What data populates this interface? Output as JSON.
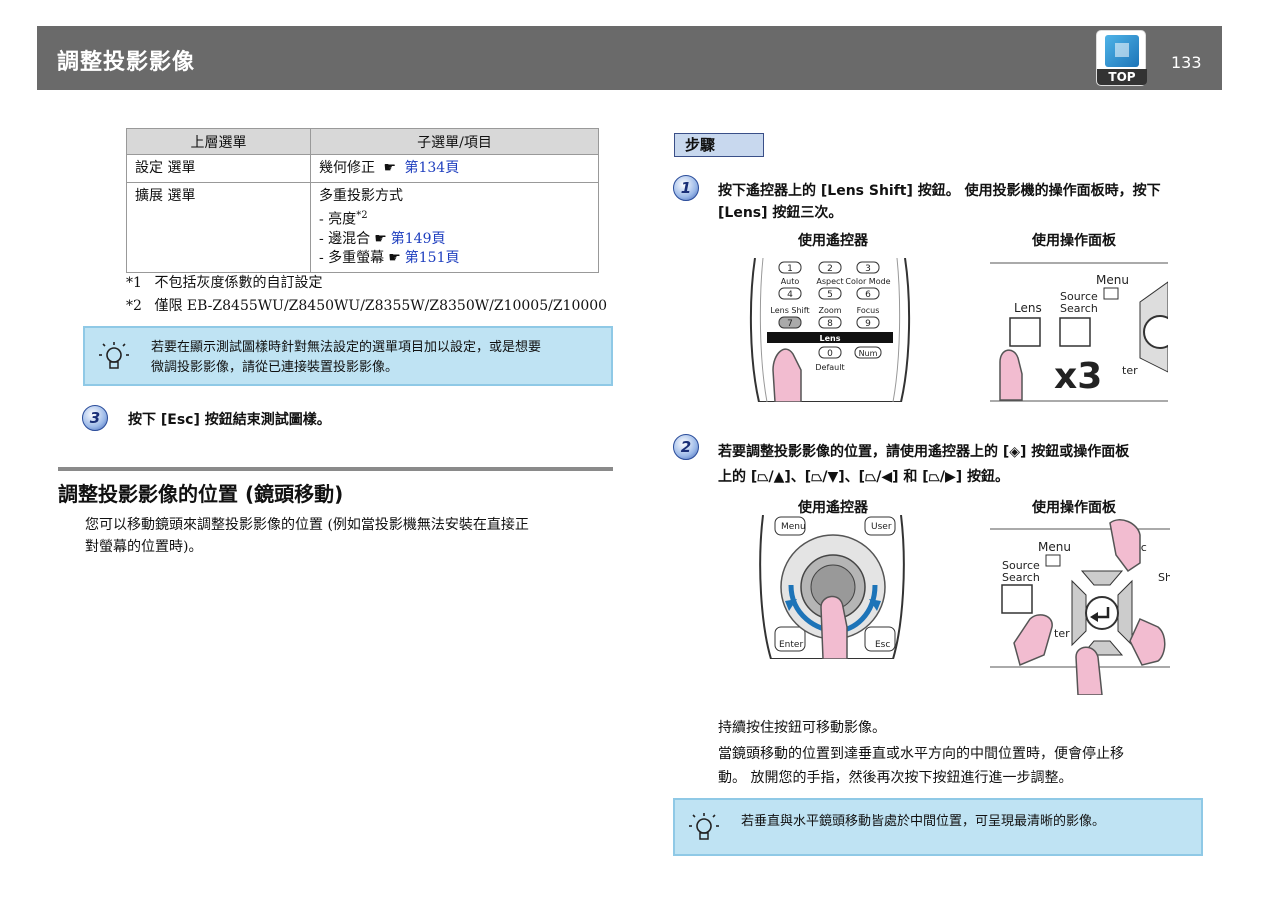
{
  "header": {
    "title": "調整投影影像",
    "top_label": "TOP",
    "page_number": "133"
  },
  "menu_table": {
    "headers": [
      "上層選單",
      "子選單/項目"
    ],
    "rows": [
      {
        "menu": "設定 選單",
        "items": [
          {
            "text": "幾何修正",
            "link": "第134頁"
          }
        ]
      },
      {
        "menu": "擴展 選單",
        "items": [
          {
            "text": "多重投影方式",
            "link": ""
          },
          {
            "text": "- 亮度",
            "sup": "*2",
            "link": ""
          },
          {
            "text": "- 邊混合",
            "link": "第149頁"
          },
          {
            "text": "- 多重螢幕",
            "link": "第151頁"
          }
        ]
      }
    ],
    "hand_symbol": "☛"
  },
  "notes": [
    {
      "key": "*1",
      "text": "不包括灰度係數的自訂設定"
    },
    {
      "key": "*2",
      "text": "僅限 EB-Z8455WU/Z8450WU/Z8355W/Z8350W/Z10005/Z10000"
    }
  ],
  "tip1": {
    "line1": "若要在顯示測試圖樣時針對無法設定的選單項目加以設定，或是想要",
    "line2": "微調投影影像，請從已連接裝置投影影像。"
  },
  "left_step": {
    "number": "3",
    "text": "按下 [Esc] 按鈕結束測試圖樣。"
  },
  "section": {
    "title": "調整投影影像的位置 (鏡頭移動)",
    "body_line1": "您可以移動鏡頭來調整投影影像的位置 (例如當投影機無法安裝在直接正",
    "body_line2": "對螢幕的位置時)。"
  },
  "procedure_label": "步驟",
  "step1": {
    "number": "1",
    "line1": "按下遙控器上的 [Lens Shift] 按鈕。 使用投影機的操作面板時，按下",
    "line2": "[Lens] 按鈕三次。",
    "cap_remote": "使用遙控器",
    "cap_panel": "使用操作面板",
    "remote_keys": [
      "1",
      "2",
      "3",
      "Auto",
      "Aspect",
      "Color Mode",
      "4",
      "5",
      "6",
      "Lens Shift",
      "Zoom",
      "Focus",
      "7",
      "8",
      "9",
      "Lens",
      "0",
      "Num",
      "Default"
    ],
    "panel_labels": {
      "menu": "Menu",
      "source1": "Source",
      "source2": "Search",
      "lens": "Lens",
      "x3": "x3",
      "ter": "ter"
    }
  },
  "step2": {
    "number": "2",
    "line1": "若要調整投影影像的位置，請使用遙控器上的 [◈] 按鈕或操作面板",
    "line2": "上的 [⏢/▲]、[⏢/▼]、[⏢/◀] 和 [⏢/▶] 按鈕。",
    "cap_remote": "使用遙控器",
    "cap_panel": "使用操作面板",
    "remote_labels": {
      "menu": "Menu",
      "user": "User",
      "enter": "Enter",
      "esc": "Esc"
    },
    "panel_labels": {
      "menu": "Menu",
      "source1": "Source",
      "source2": "Search",
      "esc": "sc",
      "sh": "Sh",
      "ter": "ter"
    }
  },
  "paragraphs": {
    "p1": "持續按住按鈕可移動影像。",
    "p2_line1": "當鏡頭移動的位置到達垂直或水平方向的中間位置時，便會停止移",
    "p2_line2": "動。 放開您的手指，然後再次按下按鈕進行進一步調整。"
  },
  "tip2": {
    "text": "若垂直與水平鏡頭移動皆處於中間位置，可呈現最清晰的影像。"
  },
  "colors": {
    "header_bg": "#6a6a6a",
    "tip_bg": "#bfe3f3",
    "link": "#1f3fbf",
    "finger": "#f2bcd0"
  }
}
